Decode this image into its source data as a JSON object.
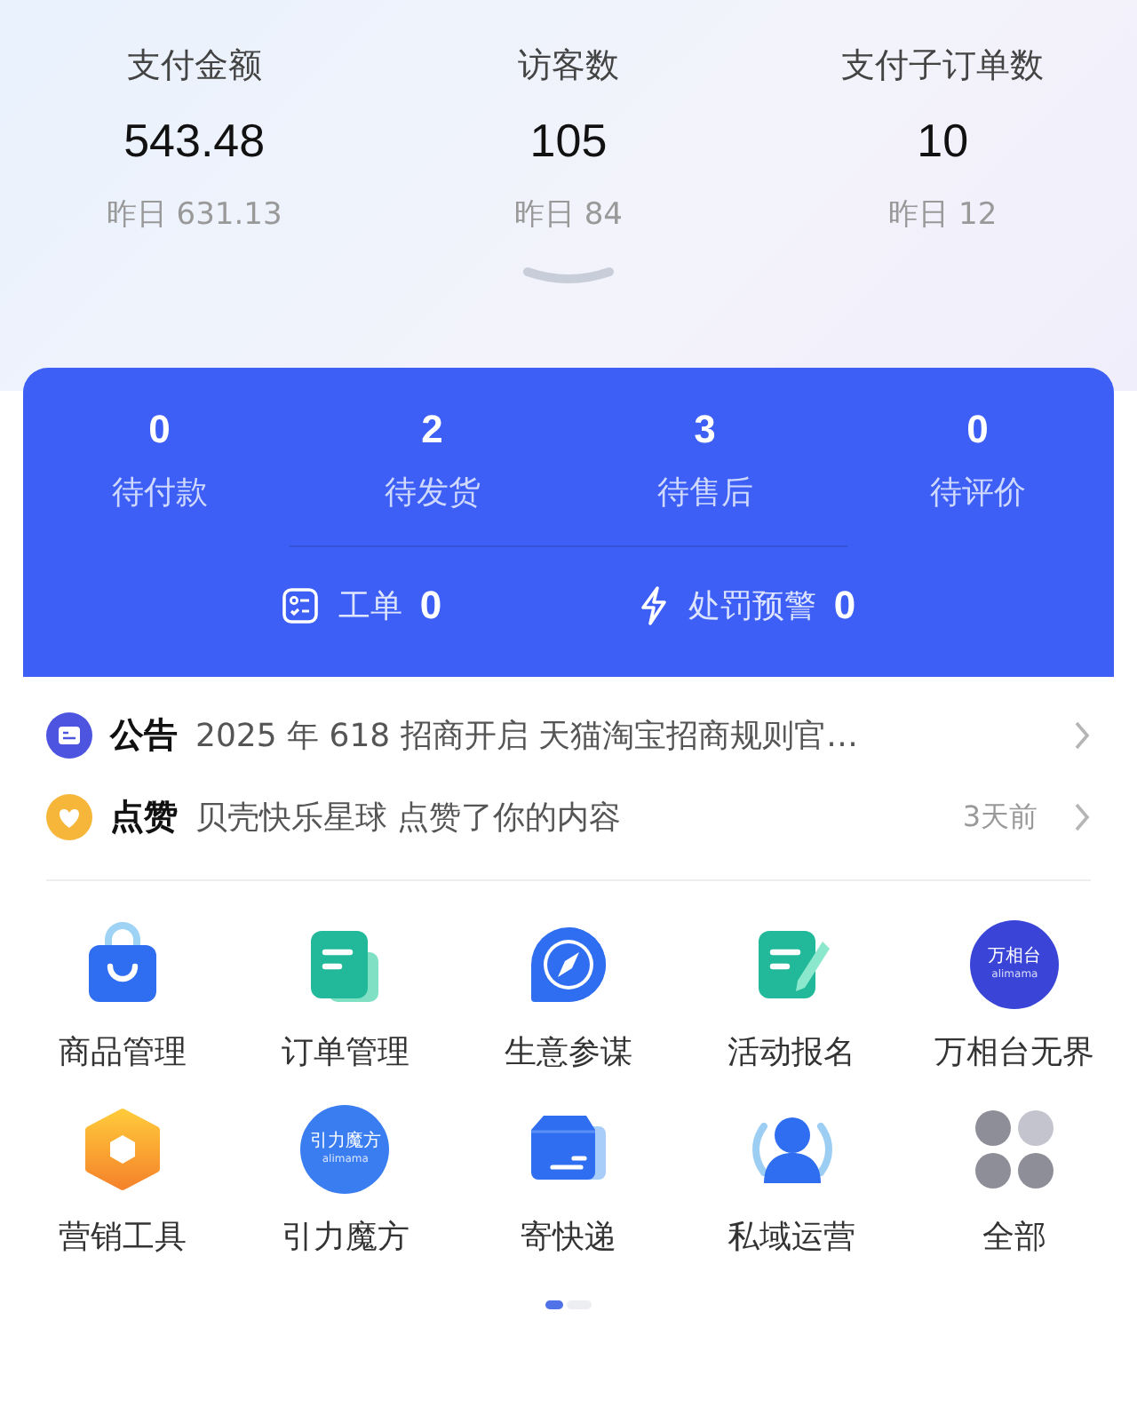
{
  "stats": [
    {
      "label": "支付金额",
      "value": "543.48",
      "yesterday": "昨日 631.13"
    },
    {
      "label": "访客数",
      "value": "105",
      "yesterday": "昨日 84"
    },
    {
      "label": "支付子订单数",
      "value": "10",
      "yesterday": "昨日 12"
    }
  ],
  "orders": [
    {
      "count": "0",
      "label": "待付款"
    },
    {
      "count": "2",
      "label": "待发货"
    },
    {
      "count": "3",
      "label": "待售后"
    },
    {
      "count": "0",
      "label": "待评价"
    }
  ],
  "alerts": [
    {
      "kind": "ticket",
      "label": "工单",
      "count": "0"
    },
    {
      "kind": "bolt",
      "label": "处罚预警",
      "count": "0"
    }
  ],
  "notices": [
    {
      "kind": "announcement",
      "title": "公告",
      "text": "2025 年 618 招商开启 天猫淘宝招商规则官…"
    },
    {
      "kind": "like",
      "title": "点赞",
      "text": "贝壳快乐星球 点赞了你的内容",
      "time": "3天前"
    }
  ],
  "tools": [
    {
      "kind": "bag",
      "label": "商品管理"
    },
    {
      "kind": "order",
      "label": "订单管理"
    },
    {
      "kind": "compass",
      "label": "生意参谋"
    },
    {
      "kind": "signup",
      "label": "活动报名"
    },
    {
      "kind": "logo",
      "label": "万相台无界",
      "logo_text": "万相台",
      "logo_sub": "alimama"
    },
    {
      "kind": "hexagon",
      "label": "营销工具"
    },
    {
      "kind": "logo",
      "label": "引力魔方",
      "logo_text": "引力魔方",
      "logo_sub": "alimama"
    },
    {
      "kind": "box",
      "label": "寄快递"
    },
    {
      "kind": "people",
      "label": "私域运营"
    },
    {
      "kind": "grid",
      "label": "全部"
    }
  ],
  "pages": [
    {
      "selected": true
    },
    {
      "selected": false
    }
  ]
}
